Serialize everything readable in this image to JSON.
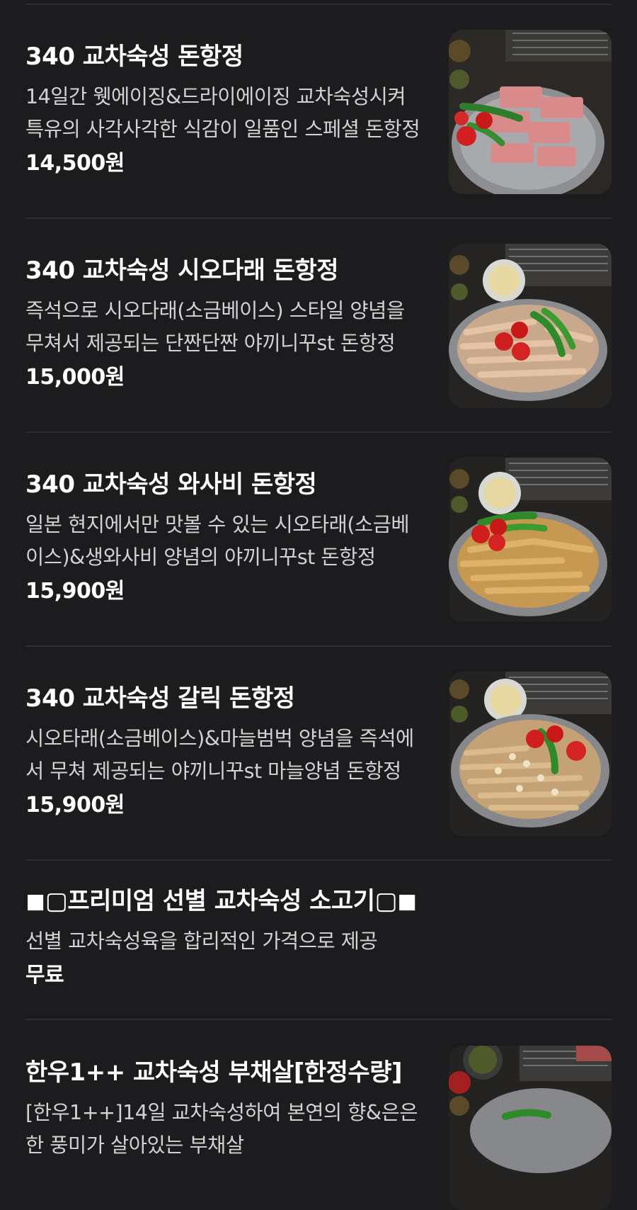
{
  "menu": {
    "items": [
      {
        "name": "340 교차숙성 돈항정",
        "description": "14일간 웻에이징&드라이에이징 교차숙성시켜 특유의 사각사각한 식감이 일품인 스페셜 돈항정",
        "price": "14,500원",
        "image": "meat-photo-icon"
      },
      {
        "name": "340 교차숙성 시오다래 돈항정",
        "description": "즉석으로 시오다래(소금베이스) 스타일 양념을 무쳐서 제공되는 단짠단짠 야끼니꾸st 돈항정",
        "price": "15,000원",
        "image": "shio-meat-photo-icon"
      },
      {
        "name": "340 교차숙성 와사비 돈항정",
        "description": "일본 현지에서만 맛볼 수 있는 시오타래(소금베이스)&생와사비 양념의 야끼니꾸st 돈항정",
        "price": "15,900원",
        "image": "wasabi-meat-photo-icon"
      },
      {
        "name": "340 교차숙성 갈릭 돈항정",
        "description": "시오타래(소금베이스)&마늘범벅 양념을 즉석에서 무쳐 제공되는 야끼니꾸st 마늘양념 돈항정",
        "price": "15,900원",
        "image": "garlic-meat-photo-icon"
      },
      {
        "name": "◼▢프리미엄 선별 교차숙성 소고기▢◼",
        "description": "선별 교차숙성육을 합리적인 가격으로 제공",
        "price": "무료",
        "image": ""
      },
      {
        "name": "한우1++ 교차숙성 부채살[한정수량]",
        "description": "[한우1++]14일 교차숙성하여 본연의 향&은은한 풍미가 살아있는 부채살",
        "price": "",
        "image": "beef-photo-icon"
      }
    ]
  },
  "colors": {
    "background": "#1c1c1e",
    "divider": "#2e2e31",
    "text_primary": "#ffffff",
    "text_secondary": "#d2d2d4"
  }
}
